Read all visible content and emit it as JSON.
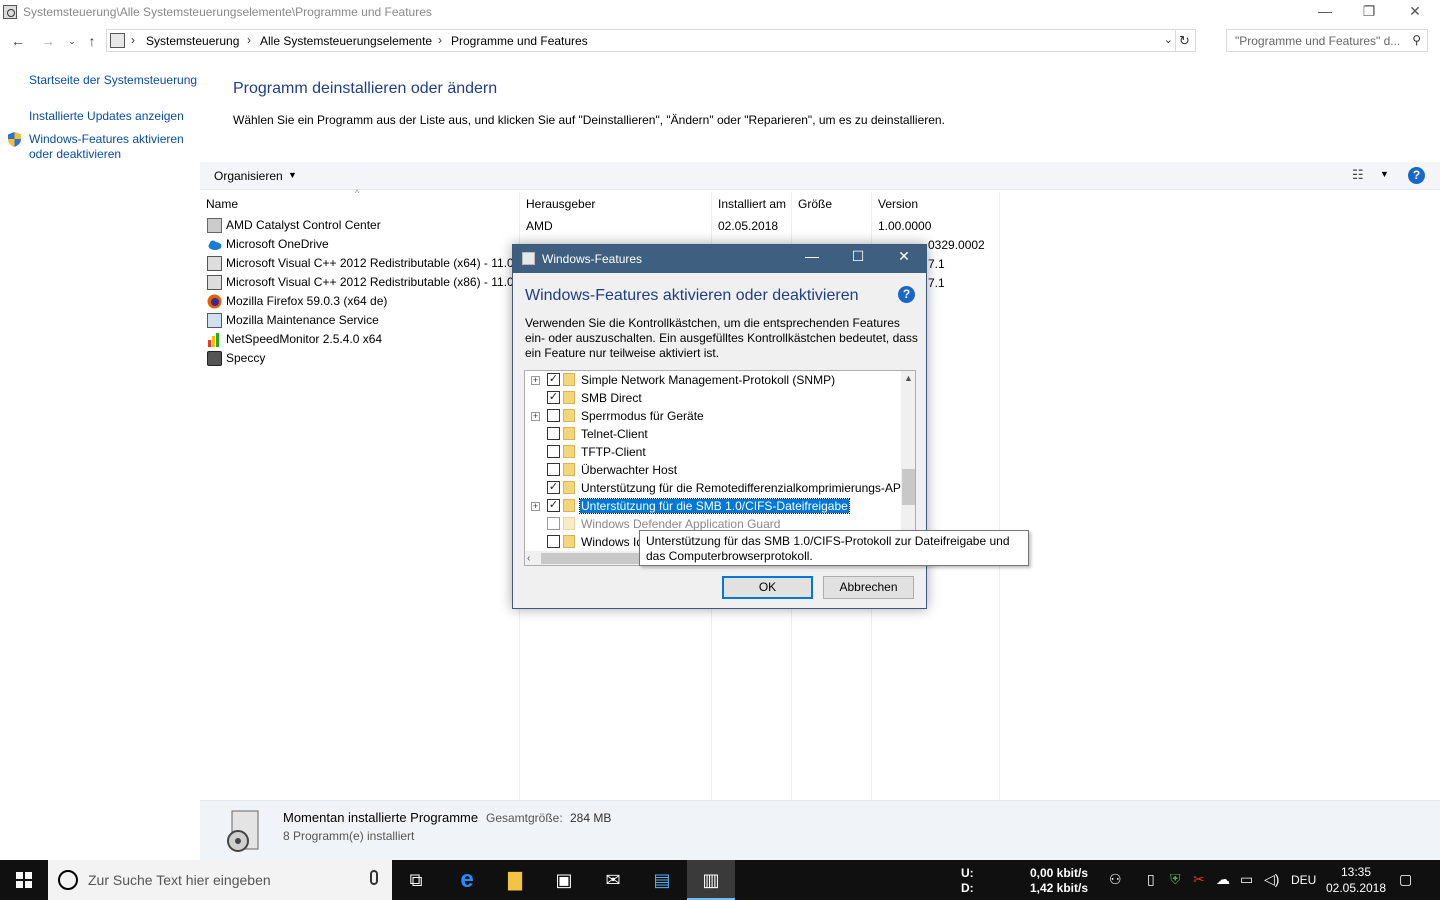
{
  "window": {
    "title": "Systemsteuerung\\Alle Systemsteuerungselemente\\Programme und Features",
    "minimize": "—",
    "maximize": "❐",
    "close": "✕"
  },
  "address": {
    "crumbs": [
      "Systemsteuerung",
      "Alle Systemsteuerungselemente",
      "Programme und Features"
    ],
    "separator": "›",
    "search_placeholder": "\"Programme und Features\" d..."
  },
  "left_pane": {
    "links": [
      "Startseite der Systemsteuerung",
      "Installierte Updates anzeigen",
      "Windows-Features aktivieren oder deaktivieren"
    ]
  },
  "main": {
    "title": "Programm deinstallieren oder ändern",
    "description": "Wählen Sie ein Programm aus der Liste aus, und klicken Sie auf \"Deinstallieren\", \"Ändern\" oder \"Reparieren\", um es zu deinstallieren."
  },
  "toolbar": {
    "organize": "Organisieren",
    "help": "?"
  },
  "columns": [
    "Name",
    "Herausgeber",
    "Installiert am",
    "Größe",
    "Version"
  ],
  "programs": [
    {
      "name": "AMD Catalyst Control Center",
      "publisher": "AMD",
      "date": "02.05.2018",
      "size": "",
      "version": "1.00.0000"
    },
    {
      "name": "Microsoft OneDrive",
      "publisher": "",
      "date": "",
      "size": "",
      "version": ""
    },
    {
      "name": "Microsoft Visual C++ 2012 Redistributable (x64) - 11.0...",
      "publisher": "",
      "date": "",
      "size": "",
      "version": ""
    },
    {
      "name": "Microsoft Visual C++ 2012 Redistributable (x86) - 11.0...",
      "publisher": "",
      "date": "",
      "size": "",
      "version": ""
    },
    {
      "name": "Mozilla Firefox 59.0.3 (x64 de)",
      "publisher": "",
      "date": "",
      "size": "",
      "version": ""
    },
    {
      "name": "Mozilla Maintenance Service",
      "publisher": "",
      "date": "",
      "size": "",
      "version": ""
    },
    {
      "name": "NetSpeedMonitor 2.5.4.0 x64",
      "publisher": "",
      "date": "",
      "size": "",
      "version": ""
    },
    {
      "name": "Speccy",
      "publisher": "",
      "date": "",
      "size": "",
      "version": ""
    }
  ],
  "partial_row2": {
    "version_tail": "0329.0002"
  },
  "partial_row3": {
    "version_tail": "7.1"
  },
  "partial_row4": {
    "version_tail": "7.1"
  },
  "details": {
    "title": "Momentan installierte Programme",
    "total_label": "Gesamtgröße:",
    "total_value": "284 MB",
    "count": "8 Programm(e) installiert"
  },
  "dialog": {
    "title": "Windows-Features",
    "heading": "Windows-Features aktivieren oder deaktivieren",
    "description": "Verwenden Sie die Kontrollkästchen, um die entsprechenden Features ein- oder auszuschalten. Ein ausgefülltes Kontrollkästchen bedeutet, dass ein Feature nur teilweise aktiviert ist.",
    "features": [
      {
        "label": "Simple Network Management-Protokoll (SNMP)",
        "expandable": true,
        "checked": true
      },
      {
        "label": "SMB Direct",
        "expandable": false,
        "checked": true
      },
      {
        "label": "Sperrmodus für Geräte",
        "expandable": true,
        "checked": false
      },
      {
        "label": "Telnet-Client",
        "expandable": false,
        "checked": false
      },
      {
        "label": "TFTP-Client",
        "expandable": false,
        "checked": false
      },
      {
        "label": "Überwachter Host",
        "expandable": false,
        "checked": false
      },
      {
        "label": "Unterstützung für die Remotedifferenzialkomprimierungs-AP",
        "expandable": false,
        "checked": true
      },
      {
        "label": "Unterstützung für die SMB 1.0/CIFS-Dateifreigabe",
        "expandable": true,
        "checked": true
      },
      {
        "label": "Windows Defender Application Guard",
        "expandable": false,
        "checked": false
      },
      {
        "label": "Windows Id",
        "expandable": false,
        "checked": false
      }
    ],
    "ok": "OK",
    "cancel": "Abbrechen",
    "tooltip": "Unterstützung für das SMB 1.0/CIFS-Protokoll zur Dateifreigabe und das Computerbrowserprotokoll."
  },
  "taskbar": {
    "search_placeholder": "Zur Suche Text hier eingeben",
    "net_up_label": "U:",
    "net_down_label": "D:",
    "net_up": "0,00 kbit/s",
    "net_down": "1,42 kbit/s",
    "lang": "DEU",
    "time": "13:35",
    "date": "02.05.2018"
  }
}
